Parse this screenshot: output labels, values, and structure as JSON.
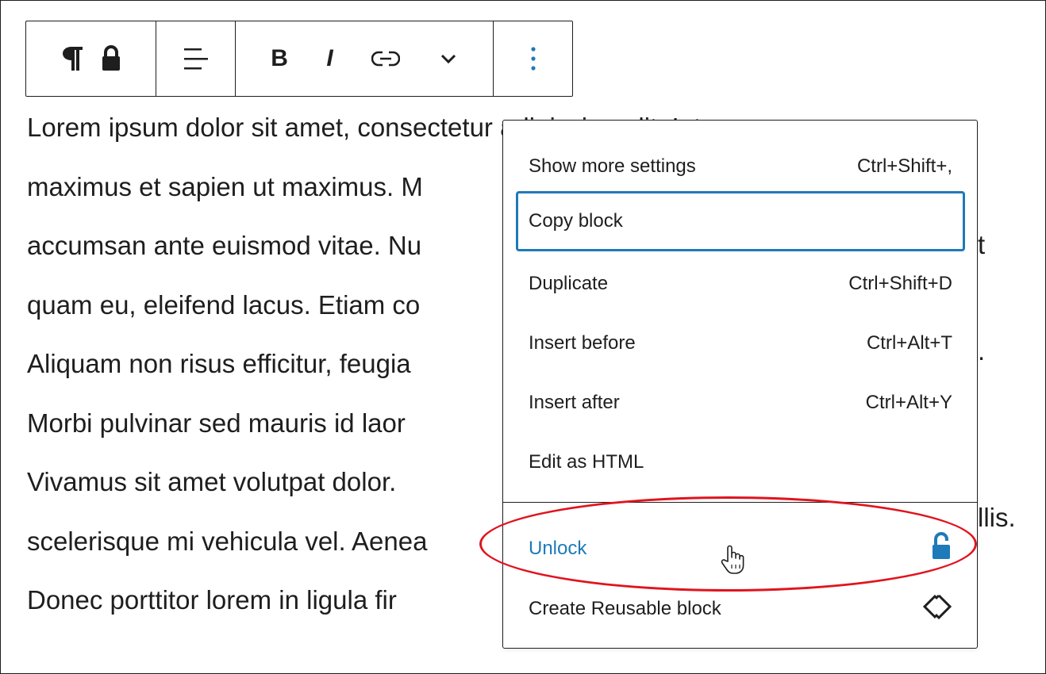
{
  "toolbar": {
    "icons": [
      "paragraph-icon",
      "lock-icon",
      "align-left-icon",
      "bold-icon",
      "italic-icon",
      "link-icon",
      "chevron-down-icon",
      "more-options-icon"
    ],
    "bold_label": "B",
    "italic_label": "I"
  },
  "paragraph": {
    "lines": [
      "Lorem ipsum dolor sit amet, consectetur adipiscing elit. Integer",
      "maximus et sapien ut maximus. M",
      "accumsan ante euismod vitae. Nu",
      "quam eu, eleifend lacus. Etiam co",
      "Aliquam non risus efficitur, feugia",
      "Morbi pulvinar sed mauris id laor",
      "Vivamus sit amet volutpat dolor.",
      "scelerisque mi vehicula vel. Aenea",
      "Donec porttitor lorem in ligula fir"
    ],
    "right_fragments": {
      "line3": "t",
      "line5": ".",
      "line8": "llis."
    }
  },
  "menu": {
    "items": [
      {
        "label": "Show more settings",
        "shortcut": "Ctrl+Shift+,"
      },
      {
        "label": "Copy block",
        "shortcut": ""
      },
      {
        "label": "Duplicate",
        "shortcut": "Ctrl+Shift+D"
      },
      {
        "label": "Insert before",
        "shortcut": "Ctrl+Alt+T"
      },
      {
        "label": "Insert after",
        "shortcut": "Ctrl+Alt+Y"
      },
      {
        "label": "Edit as HTML",
        "shortcut": ""
      }
    ],
    "unlock_label": "Unlock",
    "reusable_label": "Create Reusable block"
  },
  "colors": {
    "accent": "#1e7ab8",
    "annotation": "#e0141e",
    "text": "#1e1e1e"
  }
}
